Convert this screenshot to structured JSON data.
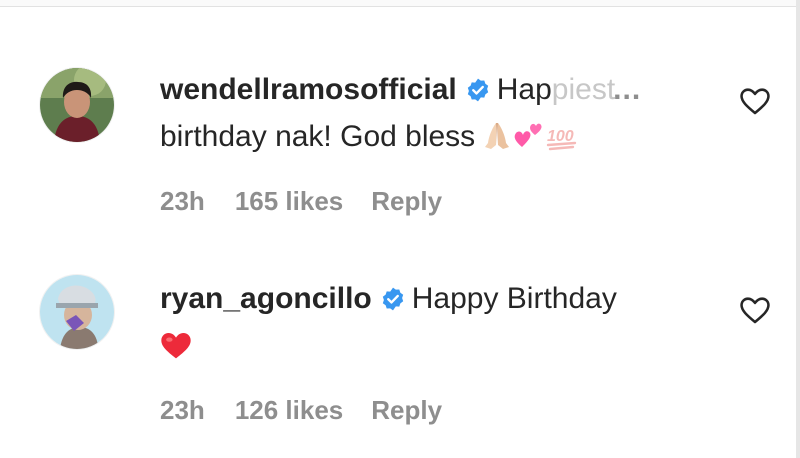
{
  "comments": [
    {
      "username": "wendellramosofficial",
      "text_visible": "Hap",
      "text_faded": "piest",
      "more": "...",
      "line2": "birthday nak! God bless",
      "emoji": [
        "🙏🏻",
        "💕",
        "💯"
      ],
      "time": "23h",
      "likes": "165 likes",
      "reply": "Reply"
    },
    {
      "username": "ryan_agoncillo",
      "text_visible": "Happy Birthday",
      "emoji": [
        "❤️"
      ],
      "time": "23h",
      "likes": "126 likes",
      "reply": "Reply"
    }
  ],
  "colors": {
    "text": "#262626",
    "secondary": "#8e8e8e",
    "verified": "#3897f0",
    "heart_red": "#ed4956"
  },
  "icons": [
    "verified-badge-icon",
    "heart-outline-icon"
  ]
}
